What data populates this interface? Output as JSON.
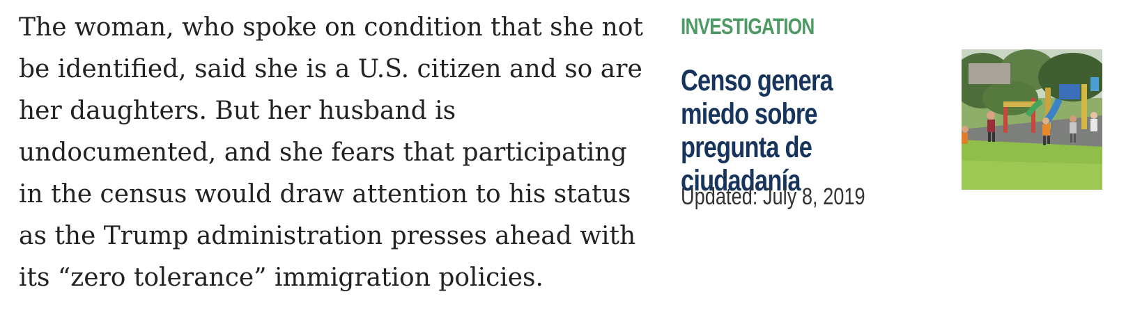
{
  "article": {
    "paragraph": "The woman, who spoke on condition that she not be identified, said she is a U.S. citizen and so are her daughters. But her husband is undocumented, and she fears that participating in the census would draw attention to his status as the Trump administration presses ahead with its “zero tolerance” immigration policies."
  },
  "related": {
    "category": "INVESTIGATION",
    "headline": "Censo genera miedo sobre pregunta de ciudadanía",
    "updated": "Updated: July 8, 2019",
    "thumbnail_icon": "playground-photo",
    "colors": {
      "category": "#4e9a64",
      "headline": "#17345c",
      "body_text": "#222222"
    }
  }
}
